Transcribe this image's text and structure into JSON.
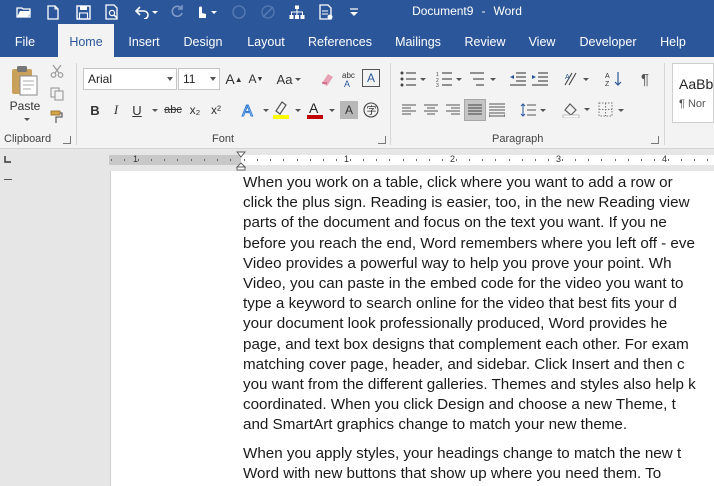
{
  "window": {
    "title": "Document9",
    "separator": "-",
    "app": "Word"
  },
  "tabs": [
    {
      "label": "File"
    },
    {
      "label": "Home",
      "active": true
    },
    {
      "label": "Insert"
    },
    {
      "label": "Design"
    },
    {
      "label": "Layout"
    },
    {
      "label": "References"
    },
    {
      "label": "Mailings"
    },
    {
      "label": "Review"
    },
    {
      "label": "View"
    },
    {
      "label": "Developer"
    },
    {
      "label": "Help"
    }
  ],
  "ribbon": {
    "clipboard": {
      "paste_label": "Paste",
      "group_label": "Clipboard"
    },
    "font": {
      "family": "Arial",
      "size": "11",
      "grow_label": "A",
      "shrink_label": "A",
      "case_label": "Aa",
      "bold": "B",
      "italic": "I",
      "underline": "U",
      "strike": "abc",
      "subscript": "x₂",
      "superscript": "x²",
      "group_label": "Font"
    },
    "paragraph": {
      "group_label": "Paragraph"
    },
    "styles": {
      "preview": "AaBb",
      "normal_label": "¶ Nor"
    }
  },
  "ruler": {
    "numbers": [
      "1",
      "1",
      "2",
      "3",
      "4"
    ]
  },
  "document": {
    "paragraph1": [
      "When you work on a table, click where you want to add a row or",
      "click the plus sign. Reading is easier, too, in the new Reading view",
      "parts of the document and focus on the text you want. If you ne",
      "before you reach the end, Word remembers where you left off - eve",
      "Video provides a powerful way to help you prove your point. Wh",
      "Video, you can paste in the embed code for the video you want to",
      "type a keyword to search online for the video that best fits your d",
      "your document look professionally produced, Word provides he",
      "page, and text box designs that complement each other. For exam",
      "matching cover page, header, and sidebar. Click Insert and then c",
      "you want from the different galleries. Themes and styles also help k",
      "coordinated. When you click Design and choose a new Theme, t",
      "and SmartArt graphics change to match your new theme."
    ],
    "paragraph2": [
      "When you apply styles, your headings change to match the new t",
      "Word with new buttons that show up where you need them. To"
    ]
  },
  "colors": {
    "accent": "#2b579a",
    "ribbon_bg": "#f3f3f3",
    "highlight": "#ffff00",
    "font_color": "#c00000"
  }
}
